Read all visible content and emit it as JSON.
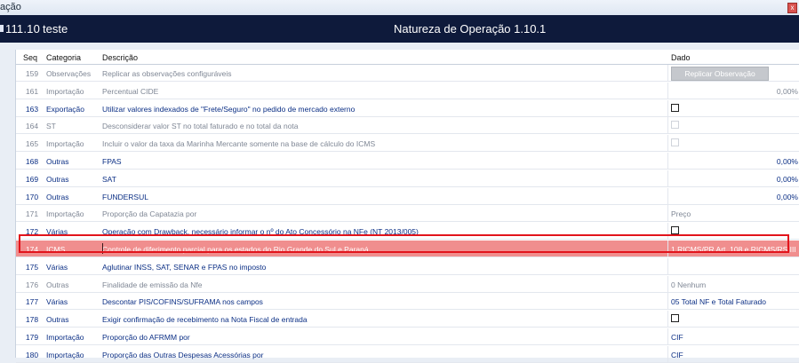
{
  "window": {
    "title": "ação",
    "close_glyph": "x"
  },
  "header": {
    "code": "111.10",
    "name": "teste",
    "center_title": "Natureza de Operação 1.10.1"
  },
  "columns": {
    "seq": "Seq",
    "cat": "Categoria",
    "desc": "Descrição",
    "dado": "Dado"
  },
  "rows": [
    {
      "seq": "159",
      "cat": "Observações",
      "desc": "Replicar as observações configuráveis",
      "dado_type": "button",
      "dado": "Replicar Observação",
      "state": "disabled"
    },
    {
      "seq": "161",
      "cat": "Importação",
      "desc": "Percentual CIDE",
      "dado_type": "percent",
      "dado": "0,00%",
      "state": "disabled"
    },
    {
      "seq": "163",
      "cat": "Exportação",
      "desc": "Utilizar valores indexados de \"Frete/Seguro\" no pedido de mercado externo",
      "dado_type": "checkbox",
      "dado": "",
      "state": "active"
    },
    {
      "seq": "164",
      "cat": "ST",
      "desc": "Desconsiderar valor ST no total faturado e no total da nota",
      "dado_type": "checkbox_disabled",
      "dado": "",
      "state": "disabled"
    },
    {
      "seq": "165",
      "cat": "Importação",
      "desc": "Incluir o valor da taxa da Marinha Mercante somente na base de cálculo do ICMS",
      "dado_type": "checkbox_disabled",
      "dado": "",
      "state": "disabled"
    },
    {
      "seq": "168",
      "cat": "Outras",
      "desc": "FPAS",
      "dado_type": "percent",
      "dado": "0,00%",
      "state": "active"
    },
    {
      "seq": "169",
      "cat": "Outras",
      "desc": "SAT",
      "dado_type": "percent",
      "dado": "0,00%",
      "state": "active"
    },
    {
      "seq": "170",
      "cat": "Outras",
      "desc": "FUNDERSUL",
      "dado_type": "percent",
      "dado": "0,00%",
      "state": "active"
    },
    {
      "seq": "171",
      "cat": "Importação",
      "desc": "Proporção da Capatazia por",
      "dado_type": "text",
      "dado": "Preço",
      "state": "disabled"
    },
    {
      "seq": "172",
      "cat": "Várias",
      "desc": "Operação com Drawback, necessário informar o nº do Ato Concessório na NFe (NT 2013/005)",
      "dado_type": "checkbox",
      "dado": "",
      "state": "active"
    },
    {
      "seq": "174",
      "cat": "ICMS",
      "desc": "Controle de diferimento parcial para os estados do Rio Grande do Sul e Paraná",
      "dado_type": "text",
      "dado": "1 RICMS/PR Art. 108 e RICMS/RS III",
      "state": "selected"
    },
    {
      "seq": "175",
      "cat": "Várias",
      "desc": "Aglutinar INSS, SAT, SENAR e FPAS no imposto",
      "dado_type": "none",
      "dado": "",
      "state": "active"
    },
    {
      "seq": "176",
      "cat": "Outras",
      "desc": "Finalidade de emissão da Nfe",
      "dado_type": "text",
      "dado": "0  Nenhum",
      "state": "disabled"
    },
    {
      "seq": "177",
      "cat": "Várias",
      "desc": "Descontar PIS/COFINS/SUFRAMA nos campos",
      "dado_type": "text",
      "dado": "05 Total NF e Total Faturado",
      "state": "active"
    },
    {
      "seq": "178",
      "cat": "Outras",
      "desc": "Exigir confirmação de recebimento na Nota Fiscal de entrada",
      "dado_type": "checkbox",
      "dado": "",
      "state": "active"
    },
    {
      "seq": "179",
      "cat": "Importação",
      "desc": "Proporção do AFRMM por",
      "dado_type": "text",
      "dado": "CIF",
      "state": "active"
    },
    {
      "seq": "180",
      "cat": "Importação",
      "desc": "Proporção das Outras Despesas Acessórias por",
      "dado_type": "text",
      "dado": "CIF",
      "state": "active"
    }
  ]
}
